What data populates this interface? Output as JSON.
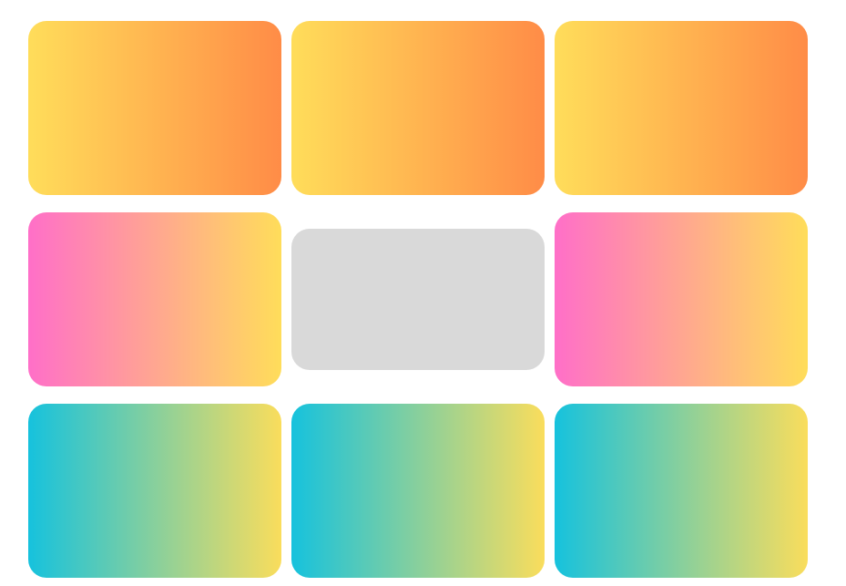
{
  "palette": {
    "warm": {
      "start": "#ffdd5a",
      "end": "#ff8c47"
    },
    "pink": {
      "start": "#ff6fc8",
      "end": "#ffdd5a"
    },
    "teal": {
      "start": "#16c2dd",
      "end": "#fadd5c"
    },
    "placeholder": "#d9d9d9"
  },
  "tiles": [
    {
      "row": 1,
      "col": 1,
      "gradient": "warm"
    },
    {
      "row": 1,
      "col": 2,
      "gradient": "warm"
    },
    {
      "row": 1,
      "col": 3,
      "gradient": "warm"
    },
    {
      "row": 2,
      "col": 1,
      "gradient": "pink"
    },
    {
      "row": 2,
      "col": 2,
      "gradient": "placeholder"
    },
    {
      "row": 2,
      "col": 3,
      "gradient": "pink"
    },
    {
      "row": 3,
      "col": 1,
      "gradient": "teal"
    },
    {
      "row": 3,
      "col": 2,
      "gradient": "teal"
    },
    {
      "row": 3,
      "col": 3,
      "gradient": "teal"
    }
  ]
}
